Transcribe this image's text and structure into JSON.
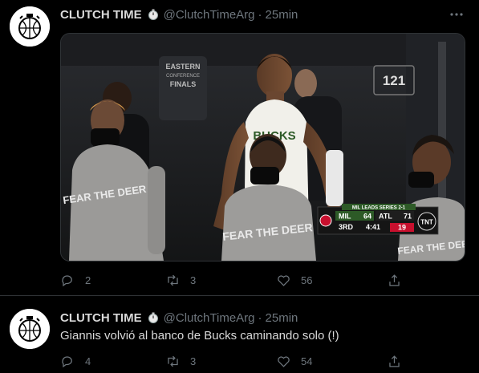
{
  "tweets": [
    {
      "display_name": "CLUTCH TIME",
      "handle": "@ClutchTimeArg",
      "separator": "·",
      "time": "25min",
      "media": {
        "scoreboard": {
          "series_text": "MIL LEADS SERIES 2-1",
          "team1": "MIL",
          "score1": "64",
          "team2": "ATL",
          "score2": "71",
          "period": "3RD",
          "clock": "4:41",
          "shot_clock": "19",
          "network": "TNT"
        },
        "arena_sign": "121",
        "banner": [
          "EASTERN",
          "CONFERENCE",
          "FINALS"
        ],
        "shirt_text": "FEAR THE DEER",
        "jersey_text": "BUCKS"
      },
      "actions": {
        "replies": "2",
        "retweets": "3",
        "likes": "56"
      }
    },
    {
      "display_name": "CLUTCH TIME",
      "handle": "@ClutchTimeArg",
      "separator": "·",
      "time": "25min",
      "text": "Giannis volvió al banco de Bucks caminando solo (!)",
      "actions": {
        "replies": "4",
        "retweets": "3",
        "likes": "54"
      }
    }
  ],
  "icons": {
    "avatar_logo": "clutch-time-logo",
    "name_emoji": "stopwatch-icon",
    "more": "more-icon",
    "reply": "reply-icon",
    "retweet": "retweet-icon",
    "like": "like-icon",
    "share": "share-icon"
  },
  "colors": {
    "background": "#000000",
    "text": "#d9d9d9",
    "muted": "#6e767d",
    "divider": "#2f3336",
    "bucks_green": "#2d5a27",
    "hawks_red": "#c8102e"
  }
}
